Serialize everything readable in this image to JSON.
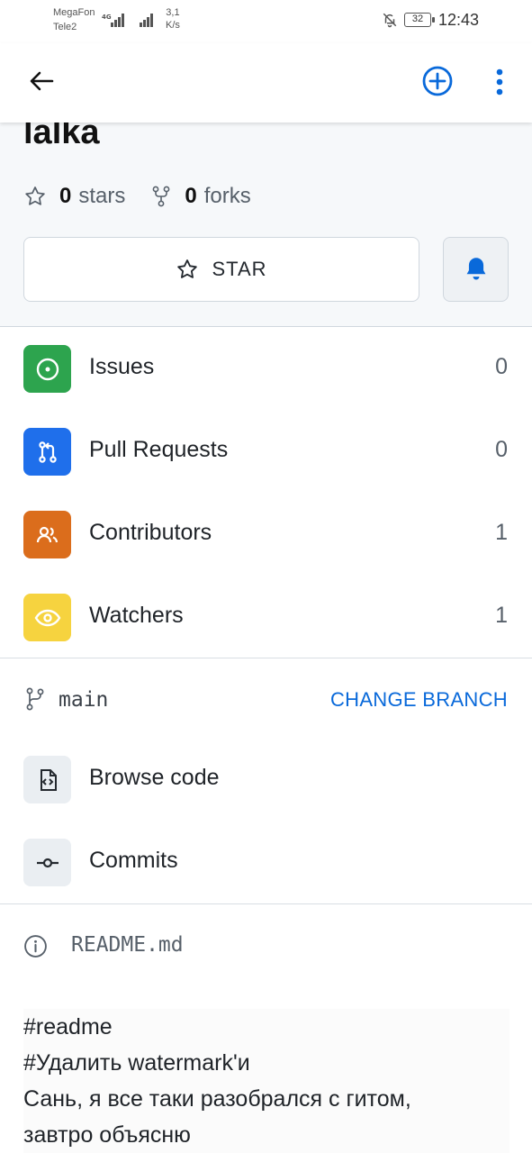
{
  "status_bar": {
    "carrier1": "MegaFon",
    "carrier2": "Tele2",
    "network": "4G",
    "speed_value": "3,1",
    "speed_unit": "K/s",
    "battery": "32",
    "time": "12:43"
  },
  "repo": {
    "name": "lalka",
    "stars_count": "0",
    "stars_label": "stars",
    "forks_count": "0",
    "forks_label": "forks",
    "star_button_label": "STAR"
  },
  "menu": [
    {
      "label": "Issues",
      "count": "0",
      "color": "#2da44e",
      "icon": "issue-icon"
    },
    {
      "label": "Pull Requests",
      "count": "0",
      "color": "#1f6feb",
      "icon": "pull-request-icon"
    },
    {
      "label": "Contributors",
      "count": "1",
      "color": "#db6d1c",
      "icon": "people-icon"
    },
    {
      "label": "Watchers",
      "count": "1",
      "color": "#f6d33f",
      "icon": "eye-icon"
    }
  ],
  "branch": {
    "name": "main",
    "change_label": "CHANGE BRANCH"
  },
  "code_links": [
    {
      "label": "Browse code",
      "icon": "file-code-icon"
    },
    {
      "label": "Commits",
      "icon": "commit-icon"
    }
  ],
  "readme": {
    "filename": "README.md",
    "lines": [
      "#readme",
      "#Удалить watermark'и",
      "Сань, я все таки разобрался с гитом,",
      "завтро объясню"
    ]
  },
  "colors": {
    "accent": "#0969da",
    "header_bg": "#f6f8fa"
  }
}
